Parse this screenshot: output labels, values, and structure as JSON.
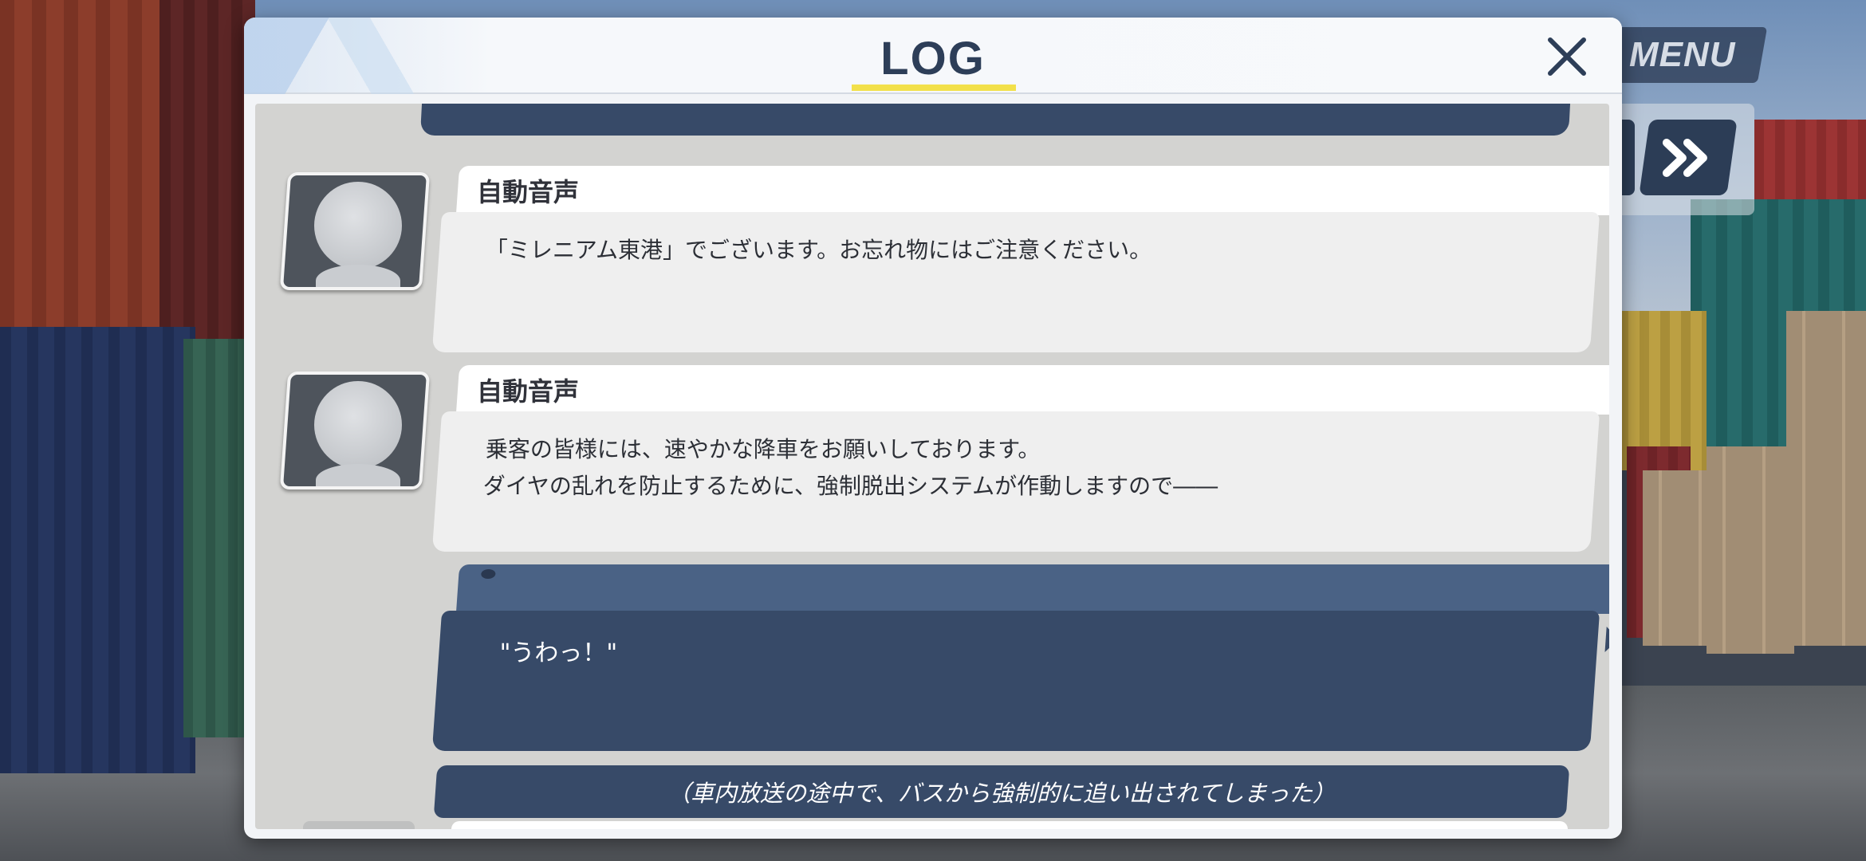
{
  "hud": {
    "menu_label": "MENU",
    "fast_forward_icon": "fast-forward-icon"
  },
  "log": {
    "title": "LOG",
    "accent_color": "#f2e04a",
    "close_icon": "close-icon",
    "entries": [
      {
        "speaker": "自動音声",
        "lines": [
          "「ミレニアム東港」でございます。お忘れ物にはご注意ください。"
        ]
      },
      {
        "speaker": "自動音声",
        "lines": [
          "乗客の皆様には、速やかな降車をお願いしております。",
          "ダイヤの乱れを防止するために、強制脱出システムが作動しますので――"
        ]
      }
    ],
    "player_line": "\"うわっ！\"",
    "narration": "（車内放送の途中で、バスから強制的に追い出されてしまった）"
  }
}
